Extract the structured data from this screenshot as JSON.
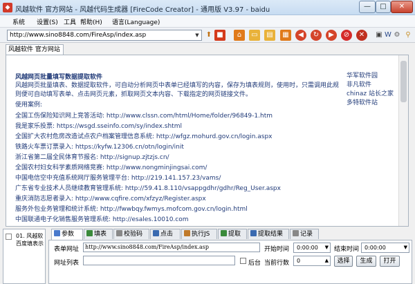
{
  "window": {
    "title": "风越软件 官方网站 - 风越代码生成器 [FireCode Creator] - 通用版 V3.97 - baidu",
    "minimize": "—",
    "maximize": "□",
    "close": "✕"
  },
  "menu": [
    "系统",
    "设置(S)",
    "工具",
    "帮助(H)",
    "语言(Language)"
  ],
  "toolbar": {
    "url": "http://www.sino8848.com/FireAsp/index.asp",
    "icons": [
      "go-icon",
      "stop-icon",
      "home-icon",
      "folder-icon",
      "open-icon",
      "window-icon",
      "back-icon",
      "refresh-icon",
      "forward-icon",
      "forbid-icon",
      "cancel-icon",
      "image-icon",
      "word-icon",
      "settings-icon",
      "search-icon"
    ]
  },
  "browser_tab": "风越软件 官方网站",
  "page": {
    "title": "风越网页批量填写数据提取软件",
    "intro": "风越网页批量填表、数据提取软件，可自动分析网页中表单已经填写的内容，保存为填表规则，使用时，只需调用此规则便可自动填写表单、点击网页元素，抓取网页文本内容、下载指定的网页链接文件。",
    "usage_label": "使用案例:",
    "side_links": [
      "华军软件园",
      "非凡软件",
      "chinaz 站长之家",
      "多特软件站"
    ],
    "sites": [
      "全国工伤保险知识网上竞答活动: http://www.clssn.com/html/Home/folder/96849-1.htm",
      "我是家乐投票: https://wsgd.sseinfo.com/sy/index.shtml",
      "全国扩大农村危房改造试点农户档案管理信息系统: http://wfgz.mohurd.gov.cn/login.aspx",
      "铁路火车票订票录入: https://kyfw.12306.cn/otn/login/init",
      "浙江省第二届全民体育节报名: http://signup.zjtzjs.cn/",
      "全国农村妇女科学素质网络竞赛: http://www.nongminjingsai.com/",
      "中国电信空中充值系统网厅服务管理平台: http://219.141.157.23/vams/",
      "广东省专业技术人员继续教育管理系统: http://59.41.8.110/vsappgdhr/gdhr/Reg_User.aspx",
      "重庆消防志愿者录入: http://www.cqfire.com/xfzyz/Register.aspx",
      "服务外包业务管理和统计系统: http://fwwbqy.fwmys.mofcom.gov.cn/login.html",
      "中国联通电子化销售服务管理系统: http://esales.10010.com"
    ]
  },
  "tree": [
    "01. 风越软",
    "百度填表示"
  ],
  "tabs": [
    "参数",
    "填表",
    "校验码",
    "点击",
    "执行JS",
    "提取",
    "提取结果",
    "记录"
  ],
  "form": {
    "url_label": "表单网址",
    "url_value": "http://www.sino8848.com/FireAsp/index.asp",
    "start_label": "开始时间",
    "start_value": "0:00:00",
    "end_label": "结束时间",
    "end_value": "0:00:00",
    "list_label": "网址列表",
    "background_label": "后台",
    "count_label": "当前行数",
    "count_value": "0",
    "select_btn": "选择",
    "generate_btn": "生成",
    "open_btn": "打开"
  }
}
